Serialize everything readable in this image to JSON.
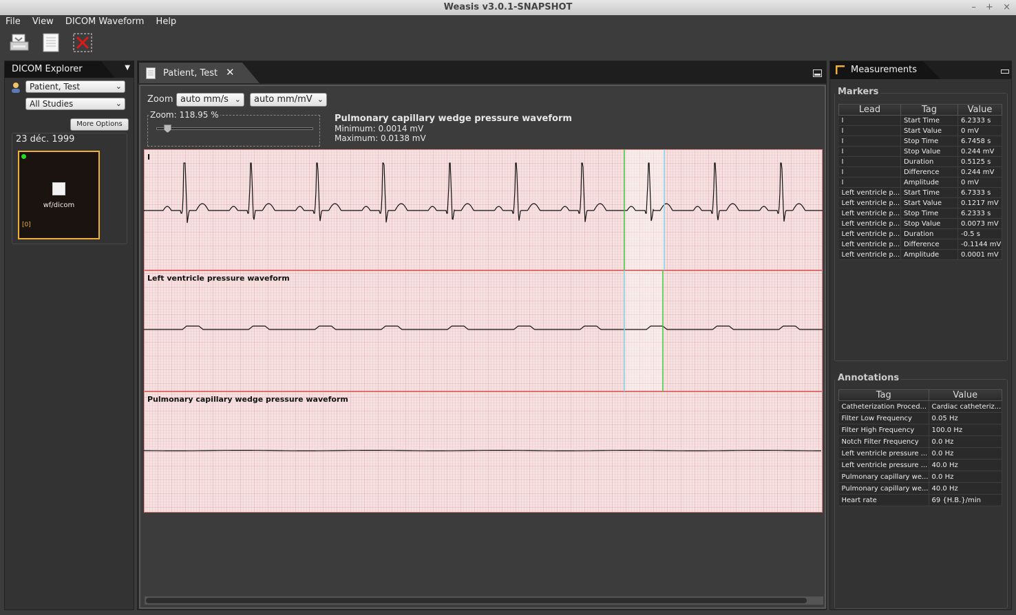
{
  "window": {
    "title": "Weasis v3.0.1-SNAPSHOT",
    "controls": [
      "–",
      "+",
      "×"
    ]
  },
  "menu": [
    "File",
    "View",
    "DICOM Waveform",
    "Help"
  ],
  "toolbar": {
    "icons": [
      "print-icon",
      "document-icon",
      "close-all-icon"
    ]
  },
  "explorer": {
    "title": "DICOM Explorer",
    "patient": "Patient, Test",
    "studies": "All Studies",
    "more_options": "More Options",
    "date": "23 déc. 1999",
    "thumbnail_label": "wf/dicom",
    "thumbnail_index": "[0]"
  },
  "viewer": {
    "tab_label": "Patient, Test",
    "zoom_label": "Zoom",
    "zoom_time": "auto mm/s",
    "zoom_amplitude": "auto mm/mV",
    "zoom_percent": "Zoom: 118.95 %",
    "zoom_level": 0.07,
    "selected_lead": "Pulmonary capillary wedge pressure waveform",
    "minimum": "Minimum: 0.0014 mV",
    "maximum": "Maximum: 0.0138 mV",
    "leads": [
      "I",
      "Left ventricle pressure waveform",
      "Pulmonary capillary wedge pressure waveform"
    ],
    "colors": {
      "grid_bg": "#f5e1e1",
      "grid_major": "#e48a8a",
      "marker_green": "#3cc83c",
      "marker_cyan": "#7fd4e8"
    }
  },
  "measurements": {
    "title": "Measurements",
    "markers_label": "Markers",
    "markers_columns": [
      "Lead",
      "Tag",
      "Value"
    ],
    "markers": [
      [
        "I",
        "Start Time",
        "6.2333 s"
      ],
      [
        "I",
        "Start Value",
        "0 mV"
      ],
      [
        "I",
        "Stop Time",
        "6.7458 s"
      ],
      [
        "I",
        "Stop Value",
        "0.244 mV"
      ],
      [
        "I",
        "Duration",
        "0.5125 s"
      ],
      [
        "I",
        "Difference",
        "0.244 mV"
      ],
      [
        "I",
        "Amplitude",
        "0 mV"
      ],
      [
        "Left ventricle p...",
        "Start Time",
        "6.7333 s"
      ],
      [
        "Left ventricle p...",
        "Start Value",
        "0.1217 mV"
      ],
      [
        "Left ventricle p...",
        "Stop Time",
        "6.2333 s"
      ],
      [
        "Left ventricle p...",
        "Stop Value",
        "0.0073 mV"
      ],
      [
        "Left ventricle p...",
        "Duration",
        "-0.5 s"
      ],
      [
        "Left ventricle p...",
        "Difference",
        "-0.1144 mV"
      ],
      [
        "Left ventricle p...",
        "Amplitude",
        "0.0001 mV"
      ]
    ],
    "annotations_label": "Annotations",
    "annotations_columns": [
      "Tag",
      "Value"
    ],
    "annotations": [
      [
        "Catheterization Proced...",
        "Cardiac catheteriz..."
      ],
      [
        "Filter Low Frequency",
        "0.05 Hz"
      ],
      [
        "Filter High Frequency",
        "100.0 Hz"
      ],
      [
        "Notch Filter Frequency",
        "0.0 Hz"
      ],
      [
        "Left ventricle pressure ...",
        "0.0 Hz"
      ],
      [
        "Left ventricle pressure ...",
        "40.0 Hz"
      ],
      [
        "Pulmonary capillary we...",
        "0.0 Hz"
      ],
      [
        "Pulmonary capillary we...",
        "40.0 Hz"
      ],
      [
        "Heart rate",
        "69 {H.B.}/min"
      ]
    ]
  }
}
